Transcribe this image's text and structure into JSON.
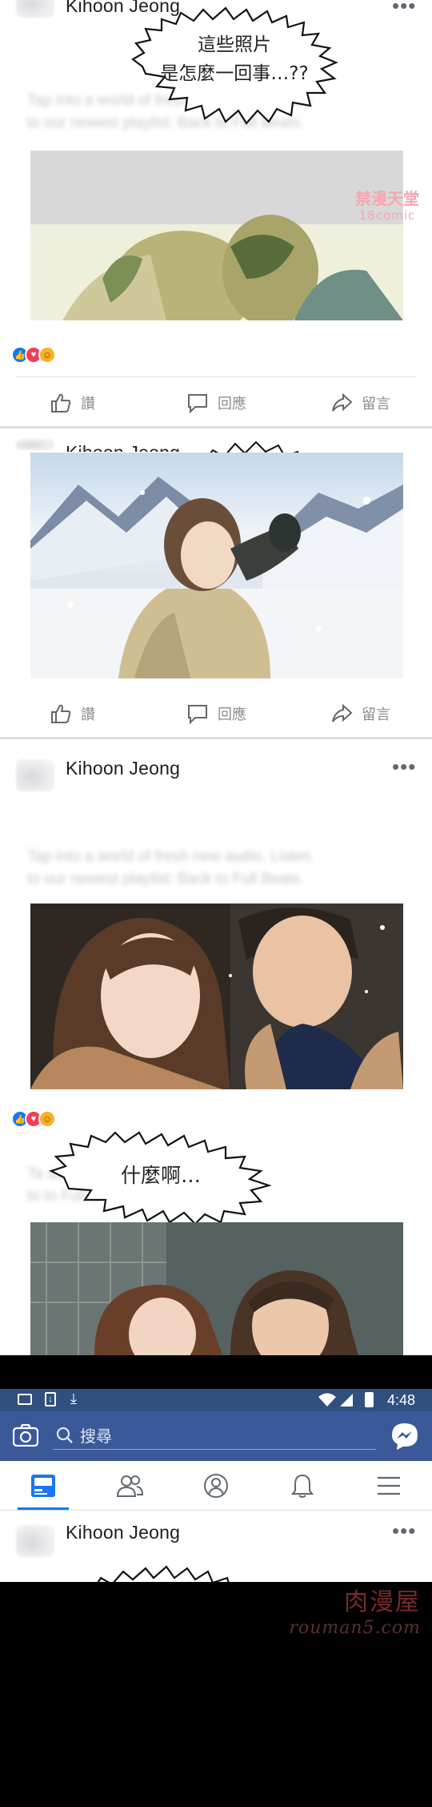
{
  "posts": [
    {
      "author": "Kihoon Jeong",
      "more": "•••",
      "blurred_caption": [
        "Tap into a world of fresh new audio. Listen",
        "to our newest playlist: Back to Full Beats."
      ],
      "bubble": [
        "這些照片",
        "是怎麼一回事…??"
      ],
      "actions": {
        "like": "讚",
        "comment": "回應",
        "share": "留言"
      }
    },
    {
      "author": "Kihoon Jeong",
      "actions": {
        "like": "讚",
        "comment": "回應",
        "share": "留言"
      }
    },
    {
      "author": "Kihoon Jeong",
      "more": "•••",
      "blurred_caption": [
        "Tap into a world of fresh new audio. Listen",
        "to our newest playlist: Back to Full Beats."
      ],
      "blurred_caption_2": [
        "Ta                             audio. Listen",
        "to                            to Full Beats."
      ],
      "bubble": [
        "什麼啊…"
      ]
    },
    {
      "author": "Kihoon Jeong",
      "more": "•••"
    }
  ],
  "status_bar": {
    "time": "4:48"
  },
  "app_bar": {
    "search_placeholder": "搜尋"
  },
  "watermarks": {
    "top": [
      "禁漫天堂",
      "18comic"
    ],
    "bottom": [
      "肉漫屋",
      "rouman5.com"
    ]
  },
  "colors": {
    "facebook_blue": "#3b5998",
    "status_bar": "#31507f",
    "like_blue": "#1877f2",
    "love_red": "#f33e58",
    "haha_yellow": "#f7b125"
  },
  "icons": {
    "tabs": [
      "news-feed-icon",
      "friends-icon",
      "profile-icon",
      "notifications-icon",
      "menu-icon"
    ],
    "status_left": [
      "image-notification-icon",
      "download-box-icon",
      "download-icon"
    ],
    "status_right": [
      "wifi-icon",
      "signal-icon",
      "battery-icon"
    ]
  }
}
